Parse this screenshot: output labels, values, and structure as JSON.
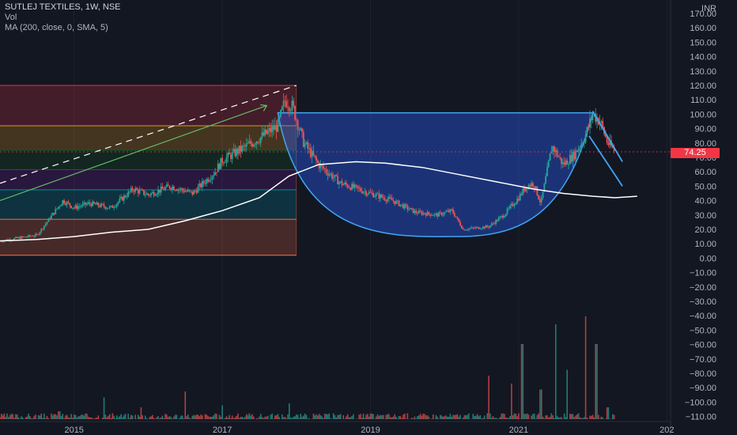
{
  "legend": {
    "title": "SUTLEJ TEXTILES, 1W, NSE",
    "vol": "Vol",
    "ma": "MA (200, close, 0, SMA, 5)"
  },
  "currency": "INR",
  "current_price": "74.25",
  "colors": {
    "background": "#131722",
    "up": "#26a69a",
    "down": "#ef5350",
    "ma": "#ffffff",
    "cup_fill": "#2962ff",
    "cup_line": "#42a5f5",
    "price_tag": "#f23645"
  },
  "chart_data": {
    "type": "candlestick",
    "title": "SUTLEJ TEXTILES, 1W, NSE",
    "x_ticks": [
      "2015",
      "2017",
      "2019",
      "2021",
      "202"
    ],
    "y_ticks": [
      "170.00",
      "160.00",
      "150.00",
      "140.00",
      "130.00",
      "120.00",
      "110.00",
      "100.00",
      "90.00",
      "80.00",
      "70.00",
      "60.00",
      "50.00",
      "40.00",
      "30.00",
      "20.00",
      "10.00",
      "0.00",
      "−10.00",
      "−20.00",
      "−30.00",
      "−40.00",
      "−50.00",
      "−60.00",
      "−70.00",
      "−80.00",
      "−90.00",
      "−100.00",
      "−110.00"
    ],
    "ylim": [
      -110,
      170
    ],
    "xlim": [
      2014.0,
      2023.05
    ],
    "price_path": [
      [
        2014.0,
        12
      ],
      [
        2014.5,
        16
      ],
      [
        2014.85,
        40
      ],
      [
        2015.0,
        35
      ],
      [
        2015.2,
        38
      ],
      [
        2015.5,
        35
      ],
      [
        2015.8,
        48
      ],
      [
        2016.0,
        44
      ],
      [
        2016.3,
        50
      ],
      [
        2016.6,
        45
      ],
      [
        2016.9,
        60
      ],
      [
        2017.0,
        68
      ],
      [
        2017.3,
        77
      ],
      [
        2017.55,
        85
      ],
      [
        2017.75,
        92
      ],
      [
        2017.85,
        110
      ],
      [
        2017.95,
        105
      ],
      [
        2018.1,
        80
      ],
      [
        2018.3,
        65
      ],
      [
        2018.6,
        52
      ],
      [
        2019.0,
        45
      ],
      [
        2019.3,
        40
      ],
      [
        2019.6,
        32
      ],
      [
        2019.9,
        30
      ],
      [
        2020.1,
        33
      ],
      [
        2020.25,
        20
      ],
      [
        2020.6,
        22
      ],
      [
        2020.8,
        30
      ],
      [
        2021.0,
        42
      ],
      [
        2021.1,
        50
      ],
      [
        2021.2,
        52
      ],
      [
        2021.3,
        38
      ],
      [
        2021.45,
        78
      ],
      [
        2021.6,
        65
      ],
      [
        2021.75,
        72
      ],
      [
        2021.9,
        85
      ],
      [
        2022.0,
        100
      ],
      [
        2022.1,
        95
      ],
      [
        2022.2,
        80
      ],
      [
        2022.3,
        74.25
      ]
    ],
    "ma_200": [
      [
        2014.0,
        12
      ],
      [
        2014.5,
        13
      ],
      [
        2015.0,
        15
      ],
      [
        2015.5,
        18
      ],
      [
        2016.0,
        20
      ],
      [
        2016.5,
        26
      ],
      [
        2017.0,
        33
      ],
      [
        2017.5,
        42
      ],
      [
        2017.9,
        57
      ],
      [
        2018.3,
        65
      ],
      [
        2018.8,
        67
      ],
      [
        2019.2,
        66
      ],
      [
        2019.7,
        63
      ],
      [
        2020.2,
        58
      ],
      [
        2020.7,
        53
      ],
      [
        2021.2,
        48
      ],
      [
        2021.6,
        45
      ],
      [
        2022.0,
        43
      ],
      [
        2022.3,
        42
      ],
      [
        2022.6,
        43
      ]
    ],
    "volume": [
      [
        2014.8,
        4
      ],
      [
        2015.4,
        11
      ],
      [
        2015.9,
        6
      ],
      [
        2016.5,
        14
      ],
      [
        2017.0,
        7
      ],
      [
        2017.9,
        8
      ],
      [
        2018.5,
        3
      ],
      [
        2019.5,
        3
      ],
      [
        2020.6,
        22
      ],
      [
        2020.9,
        18
      ],
      [
        2021.05,
        38
      ],
      [
        2021.3,
        15
      ],
      [
        2021.5,
        48
      ],
      [
        2021.65,
        25
      ],
      [
        2021.9,
        52
      ],
      [
        2022.05,
        38
      ],
      [
        2022.2,
        6
      ]
    ],
    "fib_levels": [
      {
        "value": 120.0,
        "fill": "#f23645"
      },
      {
        "value": 92.0,
        "fill": "#f7a21b"
      },
      {
        "value": 75.0,
        "fill": "#1b5e20"
      },
      {
        "value": 61.5,
        "fill": "#7b1fa2"
      },
      {
        "value": 47.5,
        "fill": "#0097a7"
      },
      {
        "value": 27.0,
        "fill": "#ff7043"
      },
      {
        "value": 2.0,
        "fill": ""
      }
    ],
    "fib_x_end": 2018.0,
    "cup": {
      "x_start": 2017.75,
      "x_end": 2022.0,
      "rim": 101,
      "bottom": 15,
      "bottom_x": 2020.2
    },
    "trend_lines": [
      {
        "name": "dashed",
        "points": [
          [
            2014.0,
            52
          ],
          [
            2018.0,
            120
          ]
        ],
        "color": "#ffffff"
      },
      {
        "name": "green-arrow",
        "points": [
          [
            2014.0,
            40
          ],
          [
            2017.6,
            106
          ]
        ],
        "color": "#66bb6a"
      }
    ],
    "channel_lines": [
      [
        [
          2022.0,
          102
        ],
        [
          2022.4,
          67
        ]
      ],
      [
        [
          2021.95,
          85
        ],
        [
          2022.4,
          50
        ]
      ]
    ]
  }
}
